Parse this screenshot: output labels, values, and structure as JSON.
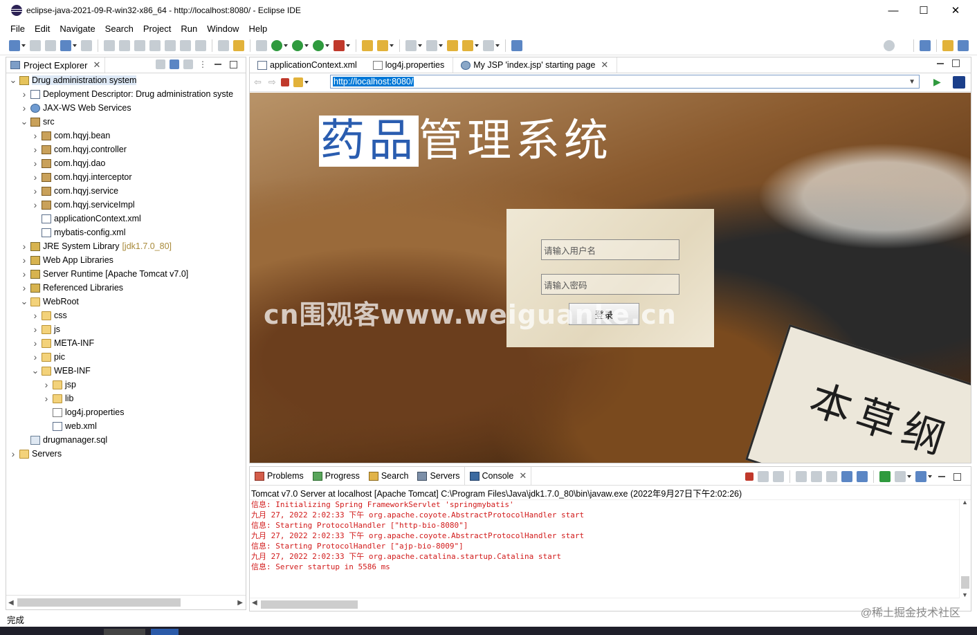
{
  "window": {
    "title": "eclipse-java-2021-09-R-win32-x86_64 - http://localhost:8080/ - Eclipse IDE",
    "minimize": "—",
    "maximize": "☐",
    "close": "✕"
  },
  "menu": [
    "File",
    "Edit",
    "Navigate",
    "Search",
    "Project",
    "Run",
    "Window",
    "Help"
  ],
  "project_explorer": {
    "tab_label": "Project Explorer",
    "tree": [
      {
        "label": "Drug administration system",
        "level": 0,
        "expanded": true,
        "icon": "project-icon",
        "selected": true
      },
      {
        "label": "Deployment Descriptor: Drug administration syste",
        "level": 1,
        "expanded": false,
        "icon": "descriptor-icon"
      },
      {
        "label": "JAX-WS Web Services",
        "level": 1,
        "expanded": false,
        "icon": "webservice-icon"
      },
      {
        "label": "src",
        "level": 1,
        "expanded": true,
        "icon": "source-folder-icon"
      },
      {
        "label": "com.hqyj.bean",
        "level": 2,
        "expanded": false,
        "icon": "package-icon"
      },
      {
        "label": "com.hqyj.controller",
        "level": 2,
        "expanded": false,
        "icon": "package-icon"
      },
      {
        "label": "com.hqyj.dao",
        "level": 2,
        "expanded": false,
        "icon": "package-icon"
      },
      {
        "label": "com.hqyj.interceptor",
        "level": 2,
        "expanded": false,
        "icon": "package-icon"
      },
      {
        "label": "com.hqyj.service",
        "level": 2,
        "expanded": false,
        "icon": "package-icon"
      },
      {
        "label": "com.hqyj.serviceImpl",
        "level": 2,
        "expanded": false,
        "icon": "package-icon"
      },
      {
        "label": "applicationContext.xml",
        "level": 2,
        "leaf": true,
        "icon": "xml-file-icon"
      },
      {
        "label": "mybatis-config.xml",
        "level": 2,
        "leaf": true,
        "icon": "xml-file-icon"
      },
      {
        "label": "JRE System Library",
        "decoration": "[jdk1.7.0_80]",
        "level": 1,
        "expanded": false,
        "icon": "library-icon"
      },
      {
        "label": "Web App Libraries",
        "level": 1,
        "expanded": false,
        "icon": "library-icon"
      },
      {
        "label": "Server Runtime [Apache Tomcat v7.0]",
        "level": 1,
        "expanded": false,
        "icon": "library-icon"
      },
      {
        "label": "Referenced Libraries",
        "level": 1,
        "expanded": false,
        "icon": "library-icon"
      },
      {
        "label": "WebRoot",
        "level": 1,
        "expanded": true,
        "icon": "folder-icon"
      },
      {
        "label": "css",
        "level": 2,
        "expanded": false,
        "icon": "folder-icon"
      },
      {
        "label": "js",
        "level": 2,
        "expanded": false,
        "icon": "folder-icon"
      },
      {
        "label": "META-INF",
        "level": 2,
        "expanded": false,
        "icon": "folder-icon"
      },
      {
        "label": "pic",
        "level": 2,
        "expanded": false,
        "icon": "folder-icon"
      },
      {
        "label": "WEB-INF",
        "level": 2,
        "expanded": true,
        "icon": "folder-icon"
      },
      {
        "label": "jsp",
        "level": 3,
        "expanded": false,
        "icon": "folder-icon"
      },
      {
        "label": "lib",
        "level": 3,
        "expanded": false,
        "icon": "folder-icon"
      },
      {
        "label": "log4j.properties",
        "level": 3,
        "leaf": true,
        "icon": "properties-file-icon"
      },
      {
        "label": "web.xml",
        "level": 3,
        "leaf": true,
        "icon": "xml-file-icon"
      },
      {
        "label": "drugmanager.sql",
        "level": 1,
        "leaf": true,
        "icon": "sql-file-icon"
      },
      {
        "label": "Servers",
        "level": 0,
        "expanded": false,
        "icon": "folder-icon"
      }
    ]
  },
  "editor": {
    "tabs": [
      {
        "label": "applicationContext.xml",
        "icon": "xml-file-icon",
        "active": false
      },
      {
        "label": "log4j.properties",
        "icon": "properties-file-icon",
        "active": false
      },
      {
        "label": "My JSP 'index.jsp' starting page",
        "icon": "globe-icon",
        "active": true
      }
    ],
    "url": "http://localhost:8080/"
  },
  "webpage": {
    "title_highlight": "药品",
    "title_rest": "管理系统",
    "book_text": "本草纲",
    "username_placeholder": "请输入用户名",
    "password_placeholder": "请输入密码",
    "login_button": "登录",
    "watermark": "cn围观客www.weiguanke.cn"
  },
  "console": {
    "tabs": [
      {
        "label": "Problems",
        "icon": "problems-icon"
      },
      {
        "label": "Progress",
        "icon": "progress-icon"
      },
      {
        "label": "Search",
        "icon": "search-flashlight-icon"
      },
      {
        "label": "Servers",
        "icon": "servers-icon"
      },
      {
        "label": "Console",
        "icon": "console-icon",
        "active": true
      }
    ],
    "description": "Tomcat v7.0 Server at localhost [Apache Tomcat] C:\\Program Files\\Java\\jdk1.7.0_80\\bin\\javaw.exe  (2022年9月27日下午2:02:26)",
    "lines": [
      "信息: Initializing Spring FrameworkServlet 'springmybatis'",
      "九月 27, 2022 2:02:33 下午 org.apache.coyote.AbstractProtocolHandler start",
      "信息: Starting ProtocolHandler [\"http-bio-8080\"]",
      "九月 27, 2022 2:02:33 下午 org.apache.coyote.AbstractProtocolHandler start",
      "信息: Starting ProtocolHandler [\"ajp-bio-8009\"]",
      "九月 27, 2022 2:02:33 下午 org.apache.catalina.startup.Catalina start",
      "信息: Server startup in 5586 ms"
    ]
  },
  "status": {
    "text": "完成",
    "watermark": "@稀土掘金技术社区"
  }
}
